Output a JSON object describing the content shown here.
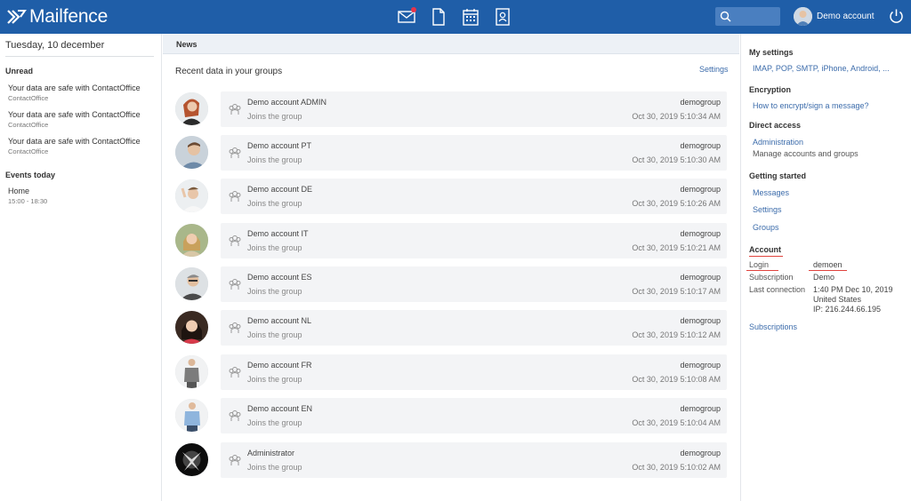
{
  "app": {
    "name": "Mailfence"
  },
  "header": {
    "account_name": "Demo account",
    "colors": {
      "bar": "#1f5ea8",
      "search_bg": "#4a7fc0",
      "notification": "#e8344a"
    },
    "nav_icons": [
      "mail-icon",
      "document-icon",
      "calendar-icon",
      "contacts-icon"
    ]
  },
  "left": {
    "date": "Tuesday, 10 december",
    "unread_heading": "Unread",
    "unread": [
      {
        "title": "Your data are safe with ContactOffice",
        "from": "ContactOffice"
      },
      {
        "title": "Your data are safe with ContactOffice",
        "from": "ContactOffice"
      },
      {
        "title": "Your data are safe with ContactOffice",
        "from": "ContactOffice"
      }
    ],
    "events_heading": "Events today",
    "events": [
      {
        "title": "Home",
        "time": "15:00 - 18:30"
      }
    ]
  },
  "center": {
    "news_title": "News",
    "recent_title": "Recent data in your groups",
    "settings_label": "Settings",
    "feed": [
      {
        "name": "Demo account ADMIN",
        "action": "Joins the group",
        "group": "demogroup",
        "time": "Oct 30, 2019 5:10:34 AM"
      },
      {
        "name": "Demo account PT",
        "action": "Joins the group",
        "group": "demogroup",
        "time": "Oct 30, 2019 5:10:30 AM"
      },
      {
        "name": "Demo account DE",
        "action": "Joins the group",
        "group": "demogroup",
        "time": "Oct 30, 2019 5:10:26 AM"
      },
      {
        "name": "Demo account IT",
        "action": "Joins the group",
        "group": "demogroup",
        "time": "Oct 30, 2019 5:10:21 AM"
      },
      {
        "name": "Demo account ES",
        "action": "Joins the group",
        "group": "demogroup",
        "time": "Oct 30, 2019 5:10:17 AM"
      },
      {
        "name": "Demo account NL",
        "action": "Joins the group",
        "group": "demogroup",
        "time": "Oct 30, 2019 5:10:12 AM"
      },
      {
        "name": "Demo account FR",
        "action": "Joins the group",
        "group": "demogroup",
        "time": "Oct 30, 2019 5:10:08 AM"
      },
      {
        "name": "Demo account EN",
        "action": "Joins the group",
        "group": "demogroup",
        "time": "Oct 30, 2019 5:10:04 AM"
      },
      {
        "name": "Administrator",
        "action": "Joins the group",
        "group": "demogroup",
        "time": "Oct 30, 2019 5:10:02 AM"
      }
    ]
  },
  "right": {
    "my_settings_heading": "My settings",
    "my_settings_link": "IMAP, POP, SMTP, iPhone, Android, ...",
    "encryption_heading": "Encryption",
    "encryption_link": "How to encrypt/sign a message?",
    "direct_access_heading": "Direct access",
    "administration_link": "Administration",
    "administration_desc": "Manage accounts and groups",
    "getting_started_heading": "Getting started",
    "getting_started_links": [
      "Messages",
      "Settings",
      "Groups"
    ],
    "account_heading": "Account",
    "login_label": "Login",
    "login_value": "demoen",
    "subscription_label": "Subscription",
    "subscription_value": "Demo",
    "last_connection_label": "Last connection",
    "last_connection_time": "1:40 PM Dec 10, 2019",
    "last_connection_country": "United States",
    "last_connection_ip": "IP: 216.244.66.195",
    "subscriptions_link": "Subscriptions",
    "highlight_color": "#e0433d"
  }
}
